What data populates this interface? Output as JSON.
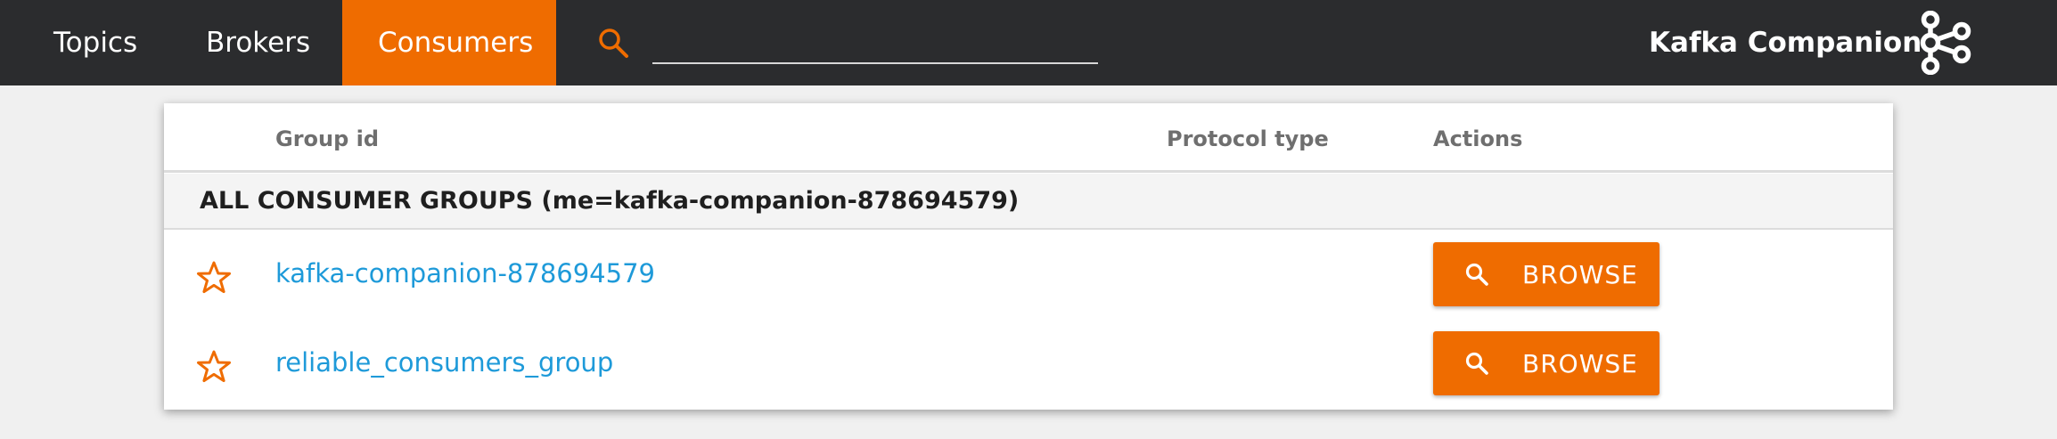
{
  "nav": {
    "tabs": [
      {
        "label": "Topics",
        "active": false
      },
      {
        "label": "Brokers",
        "active": false
      },
      {
        "label": "Consumers",
        "active": true
      }
    ],
    "search": {
      "value": "",
      "placeholder": ""
    },
    "brand": "Kafka Companion",
    "colors": {
      "bar": "#2b2c2e",
      "accent": "#ef6c00"
    }
  },
  "table": {
    "columns": {
      "group_id": "Group id",
      "protocol_type": "Protocol type",
      "actions": "Actions"
    },
    "section_title": "ALL CONSUMER GROUPS (me=kafka-companion-878694579)",
    "rows": [
      {
        "group_id": "kafka-companion-878694579",
        "protocol_type": "",
        "action_label": "BROWSE",
        "favorite": false
      },
      {
        "group_id": "reliable_consumers_group",
        "protocol_type": "",
        "action_label": "BROWSE",
        "favorite": false
      }
    ],
    "colors": {
      "link": "#1e9ad9",
      "button": "#ef6c00"
    }
  }
}
